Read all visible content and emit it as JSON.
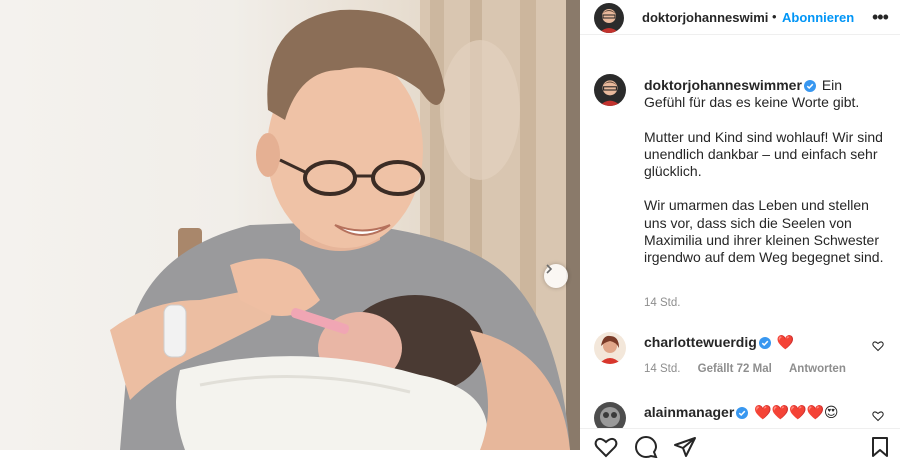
{
  "header": {
    "username": "doktorjohanneswimi",
    "separator": "•",
    "follow_label": "Abonnieren",
    "more_label": "•••"
  },
  "caption": {
    "username": "doktorjohanneswimmer",
    "lines": [
      "Ein Gefühl für das es keine Worte gibt.",
      "Mutter und Kind sind wohlauf! Wir sind unendlich dankbar – und einfach sehr glücklich.",
      "Wir umarmen das Leben und stellen uns vor, dass sich die Seelen von Maximilia und ihrer kleinen Schwester irgendwo auf dem Weg begegnet sind."
    ],
    "timestamp": "14 Std."
  },
  "comments": [
    {
      "username": "charlottewuerdig",
      "text": "❤️",
      "time": "14 Std.",
      "likes": "Gefällt 72 Mal",
      "reply": "Antworten"
    },
    {
      "username": "alainmanager",
      "text": "❤️❤️❤️❤️😍"
    }
  ],
  "colors": {
    "accent": "#0095f6",
    "verified": "#3897f0",
    "heart": "#ed4956",
    "muted": "#8e8e8e"
  },
  "icons": [
    "verified-badge-icon",
    "more-options-icon",
    "heart-outline-icon",
    "comment-icon",
    "share-icon",
    "bookmark-icon",
    "chevron-right-icon"
  ]
}
